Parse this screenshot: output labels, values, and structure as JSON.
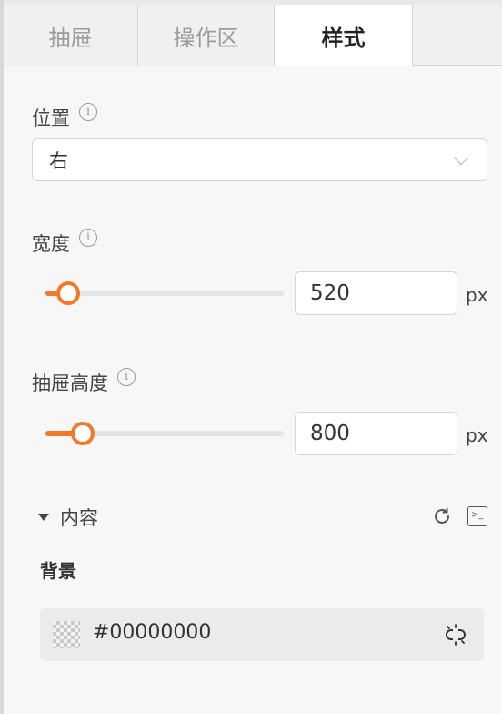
{
  "tabs": [
    {
      "label": "抽屉",
      "active": false
    },
    {
      "label": "操作区",
      "active": false
    },
    {
      "label": "样式",
      "active": true
    }
  ],
  "position": {
    "label": "位置",
    "value": "右"
  },
  "width": {
    "label": "宽度",
    "value": "520",
    "unit": "px"
  },
  "drawer_height": {
    "label": "抽屉高度",
    "value": "800",
    "unit": "px"
  },
  "content_section": {
    "label": "内容"
  },
  "background": {
    "label": "背景",
    "value": "#00000000"
  },
  "colors": {
    "accent": "#f07a2c",
    "tab_active_bg": "#ffffff",
    "panel_bg": "#f7f7f7"
  },
  "icons": {
    "info": "info-icon",
    "chevron": "chevron-down-icon",
    "refresh": "refresh-icon",
    "terminal": "terminal-icon",
    "unlink": "unlink-icon",
    "caret": "caret-down-icon"
  }
}
